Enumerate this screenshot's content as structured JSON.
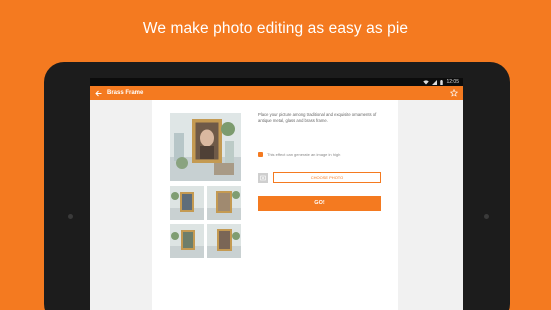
{
  "promo": {
    "headline": "We make photo editing as easy as pie"
  },
  "status_bar": {
    "time": "12:05"
  },
  "app_bar": {
    "title": "Brass Frame"
  },
  "effect": {
    "description": "Place your picture among traditional and exquisite ornaments of antique metal, glass and brass frame.",
    "hd_note": "This effect can generate an image in high",
    "choose_photo_label": "CHOOSE PHOTO",
    "go_label": "GO!"
  },
  "colors": {
    "accent": "#f47a20",
    "card": "#ffffff",
    "screen_bg": "#f1f1f1",
    "status_bar": "#0c0c0c"
  }
}
